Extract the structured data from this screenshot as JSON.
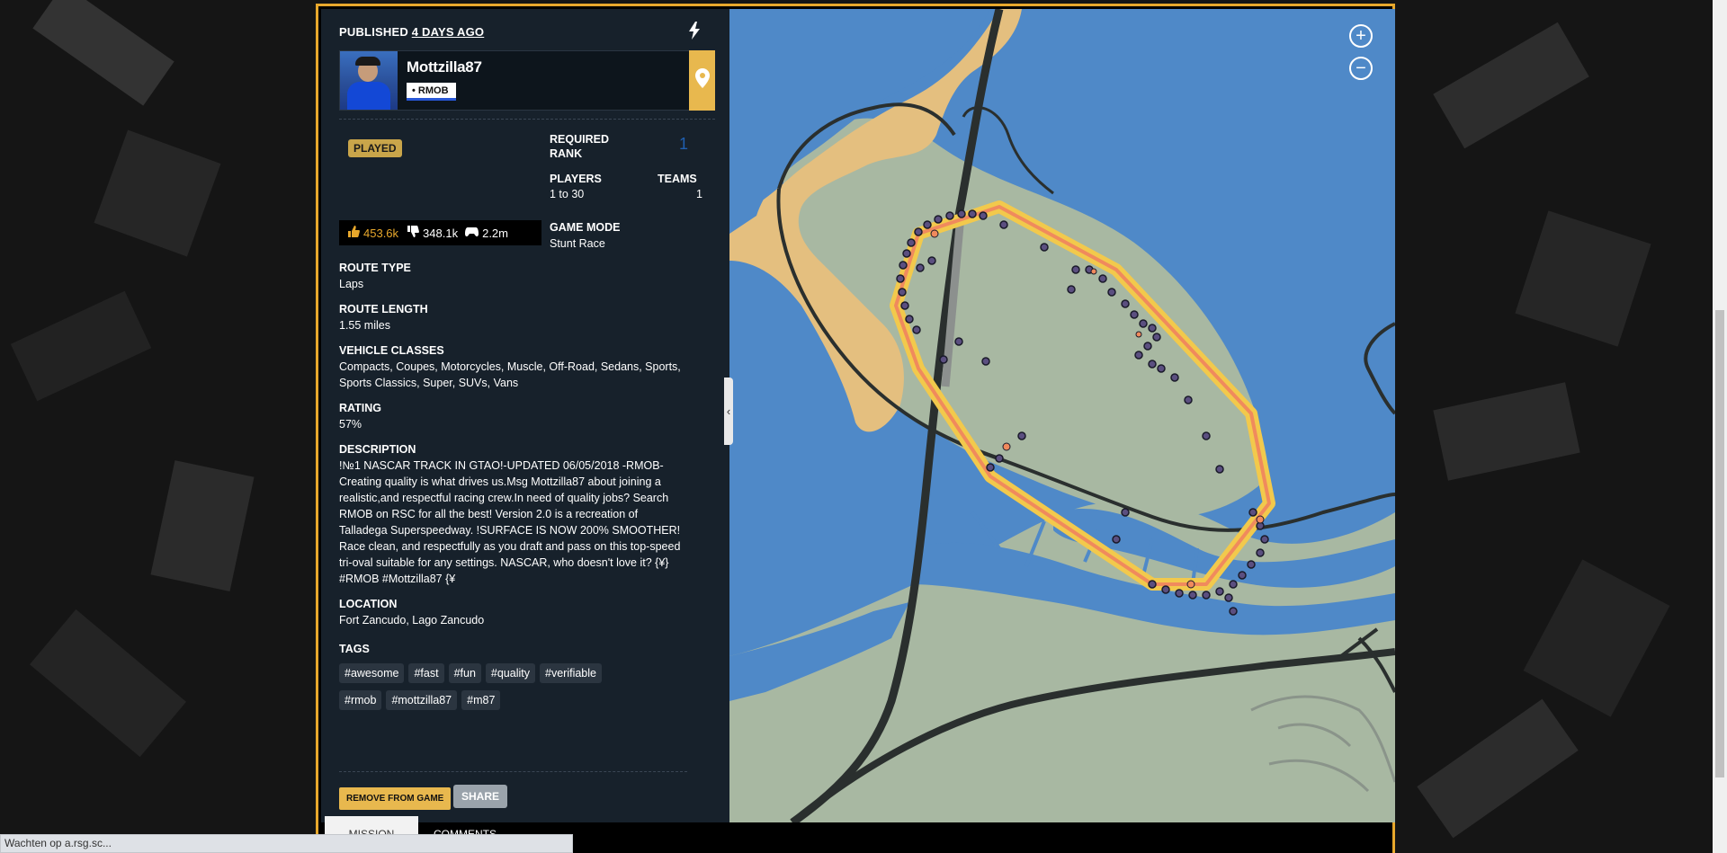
{
  "header": {
    "published_prefix": "PUBLISHED",
    "published_ago": "4 DAYS AGO"
  },
  "author": {
    "name": "Mottzilla87",
    "crew": "• RMOB"
  },
  "played_badge": "PLAYED",
  "stats": {
    "required_rank_label": "REQUIRED RANK",
    "required_rank_value": "1",
    "players_label": "PLAYERS",
    "players_value": "1 to 30",
    "teams_label": "TEAMS",
    "teams_value": "1",
    "game_mode_label": "GAME MODE",
    "game_mode_value": "Stunt Race"
  },
  "votes": {
    "likes": "453.6k",
    "dislikes": "348.1k",
    "plays": "2.2m"
  },
  "details": {
    "route_type_label": "ROUTE TYPE",
    "route_type_value": "Laps",
    "route_length_label": "ROUTE LENGTH",
    "route_length_value": "1.55 miles",
    "vehicle_classes_label": "VEHICLE CLASSES",
    "vehicle_classes_value": "Compacts, Coupes, Motorcycles, Muscle, Off-Road, Sedans, Sports, Sports Classics, Super, SUVs, Vans",
    "rating_label": "RATING",
    "rating_value": "57%",
    "description_label": "DESCRIPTION",
    "description_value": "!№1 NASCAR TRACK IN GTAO!-UPDATED 06/05/2018 -RMOB- Creating quality is what drives us.Msg Mottzilla87 about joining a realistic,and respectful racing crew.In need of quality jobs? Search RMOB on RSC for all the best! Version 2.0 is a recreation of Talladega Superspeedway. !SURFACE IS NOW 200% SMOOTHER! Race clean, and respectfully as you draft and pass on this top-speed tri-oval suitable for any settings. NASCAR, who doesn't love it? {¥} #RMOB #Mottzilla87 {¥",
    "location_label": "LOCATION",
    "location_value": "Fort Zancudo, Lago Zancudo",
    "tags_label": "TAGS"
  },
  "tags": [
    "#awesome",
    "#fast",
    "#fun",
    "#quality",
    "#verifiable",
    "#rmob",
    "#mottzilla87",
    "#m87"
  ],
  "actions": {
    "remove_label": "REMOVE FROM GAME",
    "share_label": "SHARE"
  },
  "tabs": [
    "MISSION",
    "COMMENTS"
  ],
  "map_controls": {
    "zoom_in": "+",
    "zoom_out": "−",
    "collapse": "‹"
  },
  "status_bar": "Wachten op a.rsg.sc...",
  "colors": {
    "accent": "#e8a82c",
    "panel": "#17212b",
    "water": "#4f89c8",
    "land": "#a8b8a2",
    "sand": "#e4bf7f",
    "route_outer": "#f2c94c",
    "route_inner": "#f08a5d",
    "checkpoint": "#5b4f80"
  },
  "icons": {
    "bolt": "bolt-icon",
    "location": "map-pin-icon",
    "like": "thumbs-up-icon",
    "dislike": "thumbs-down-icon",
    "plays": "gamepad-icon"
  }
}
